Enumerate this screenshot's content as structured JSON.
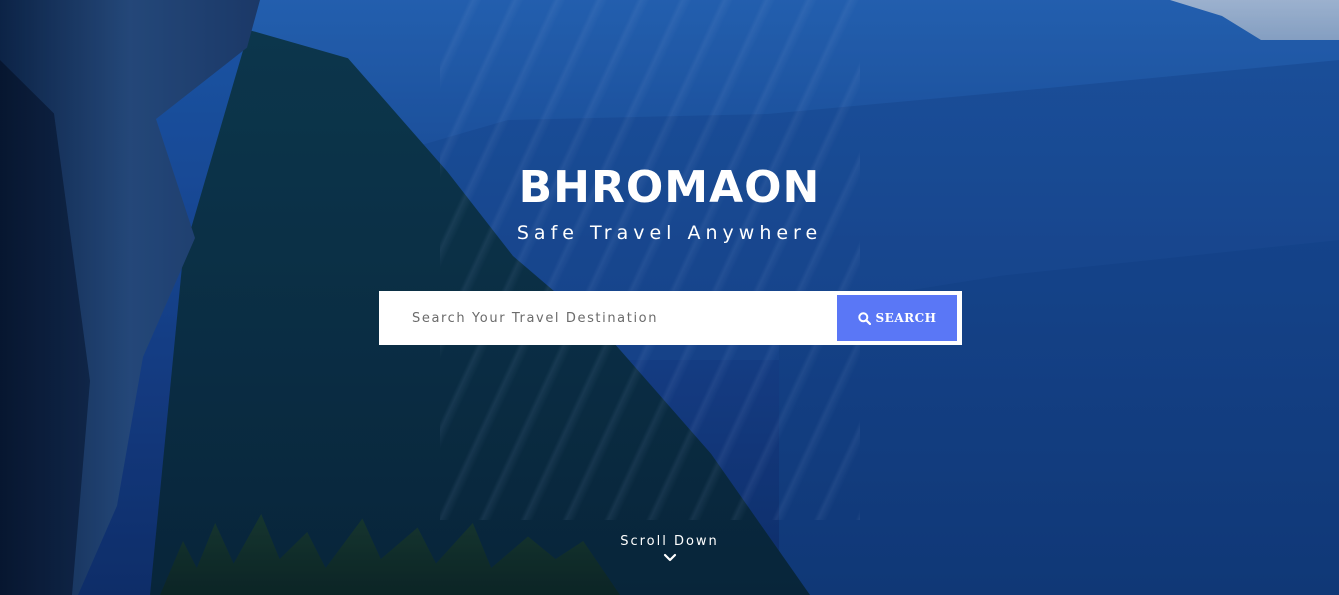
{
  "hero": {
    "brand": "BHROMAON",
    "tagline": "Safe Travel Anywhere"
  },
  "search": {
    "placeholder": "Search Your Travel Destination",
    "value": "",
    "button_label": "SEARCH",
    "button_icon": "search-icon"
  },
  "scroll": {
    "label": "Scroll Down",
    "icon": "chevron-down-icon"
  },
  "colors": {
    "accent": "#5a77f6",
    "text": "#ffffff",
    "background": "#1a4f9e"
  }
}
